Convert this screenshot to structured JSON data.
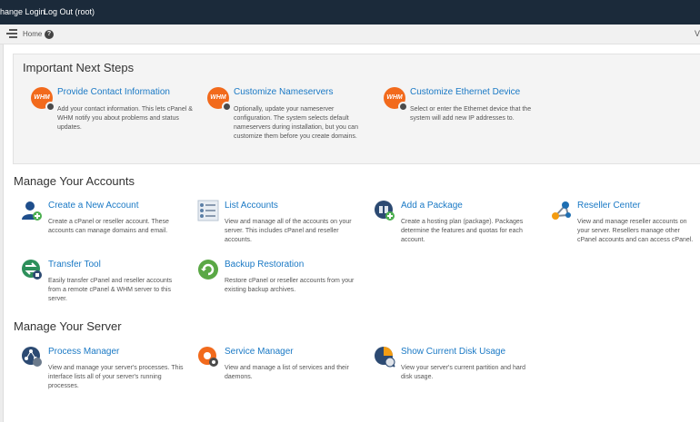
{
  "topbar": {
    "change_login": "hange Login",
    "logout": "Log Out (root)"
  },
  "toolbar": {
    "breadcrumb_home": "Home",
    "help_glyph": "?",
    "chevron": "V"
  },
  "next_steps": {
    "title": "Important Next Steps",
    "items": [
      {
        "icon": "whm-settings-icon",
        "icon_text": "WHM",
        "title": "Provide Contact Information",
        "desc": "Add your contact information. This lets cPanel & WHM notify you about problems and status updates."
      },
      {
        "icon": "whm-settings-icon",
        "icon_text": "WHM",
        "title": "Customize Nameservers",
        "desc": "Optionally, update your nameserver configuration. The system selects default nameservers during installation, but you can customize them before you create domains."
      },
      {
        "icon": "whm-settings-icon",
        "icon_text": "WHM",
        "title": "Customize Ethernet Device",
        "desc": "Select or enter the Ethernet device that the system will add new IP addresses to."
      }
    ]
  },
  "accounts": {
    "title": "Manage Your Accounts",
    "items": [
      {
        "icon": "user-add-icon",
        "title": "Create a New Account",
        "desc": "Create a cPanel or reseller account. These accounts can manage domains and email."
      },
      {
        "icon": "list-icon",
        "title": "List Accounts",
        "desc": "View and manage all of the accounts on your server. This includes cPanel and reseller accounts."
      },
      {
        "icon": "package-add-icon",
        "title": "Add a Package",
        "desc": "Create a hosting plan (package). Packages determine the features and quotas for each account."
      },
      {
        "icon": "network-icon",
        "title": "Reseller Center",
        "desc": "View and manage reseller accounts on your server. Resellers manage other cPanel accounts and can access cPanel."
      },
      {
        "icon": "transfer-icon",
        "title": "Transfer Tool",
        "desc": "Easily transfer cPanel and reseller accounts from a remote cPanel & WHM server to this server."
      },
      {
        "icon": "restore-icon",
        "title": "Backup Restoration",
        "desc": "Restore cPanel or reseller accounts from your existing backup archives."
      }
    ]
  },
  "server": {
    "title": "Manage Your Server",
    "items": [
      {
        "icon": "process-icon",
        "title": "Process Manager",
        "desc": "View and manage your server's processes. This interface lists all of your server's running processes."
      },
      {
        "icon": "service-gear-icon",
        "title": "Service Manager",
        "desc": "View and manage a list of services and their daemons."
      },
      {
        "icon": "disk-usage-icon",
        "title": "Show Current Disk Usage",
        "desc": "View your server's current partition and hard disk usage."
      }
    ]
  },
  "colors": {
    "topbar": "#1b2a3a",
    "link": "#1a79c5",
    "whm_orange": "#f26a1c",
    "green_badge": "#4caf50"
  }
}
